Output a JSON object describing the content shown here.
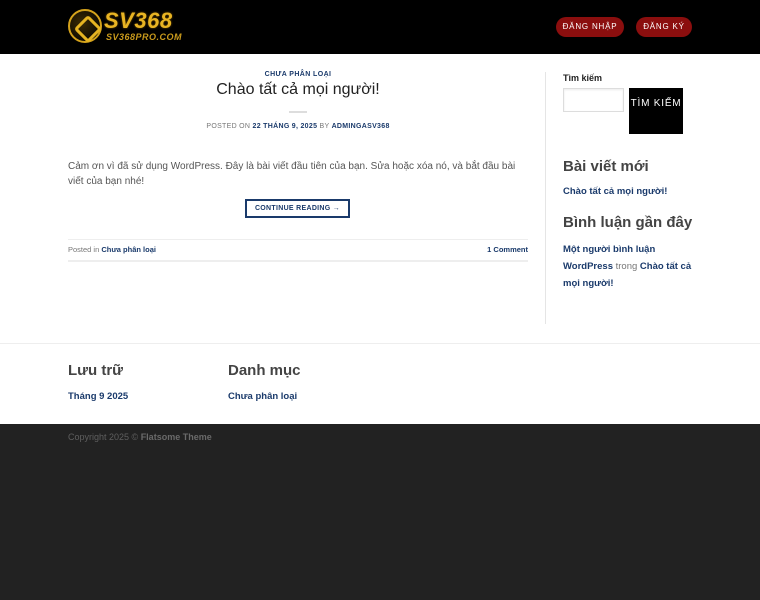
{
  "header": {
    "logo_text": "SV368",
    "logo_subtext": "SV368PRO.COM",
    "login_label": "ĐĂNG NHẬP",
    "register_label": "ĐĂNG KÝ",
    "accent_color": "#8b0e0e"
  },
  "post": {
    "category": "CHƯA PHÂN LOẠI",
    "title": "Chào tất cả mọi người!",
    "meta_prefix": "POSTED ON",
    "date": "22 THÁNG 9, 2025",
    "by": "BY",
    "author": "ADMINGASV368",
    "excerpt": "Cảm ơn vì đã sử dụng WordPress. Đây là bài viết đầu tiên của bạn. Sửa hoặc xóa nó, và bắt đầu bài viết của bạn nhé!",
    "continue_label": "CONTINUE READING →",
    "posted_in_label": "Posted in",
    "posted_in_category": "Chưa phân loại",
    "comments": "1 Comment"
  },
  "sidebar": {
    "search_label": "Tìm kiếm",
    "search_placeholder": "",
    "search_button": "TÌM KIẾM",
    "recent_posts_title": "Bài viết mới",
    "recent_post_1": "Chào tất cả mọi người!",
    "recent_comments_title": "Bình luận gần đây",
    "comment_author": "Một người bình luận WordPress",
    "comment_on": "trong",
    "comment_post": "Chào tất cả mọi người!"
  },
  "footer": {
    "archives_title": "Lưu trữ",
    "archives_item": "Tháng 9 2025",
    "categories_title": "Danh mục",
    "categories_item": "Chưa phân loại",
    "copyright_prefix": "Copyright 2025 ©",
    "copyright_theme": "Flatsome Theme"
  },
  "colors": {
    "link": "#1a3a6b",
    "header_bg": "#000000",
    "footer_bg": "#222222",
    "logo_gold": "#e8b423"
  }
}
